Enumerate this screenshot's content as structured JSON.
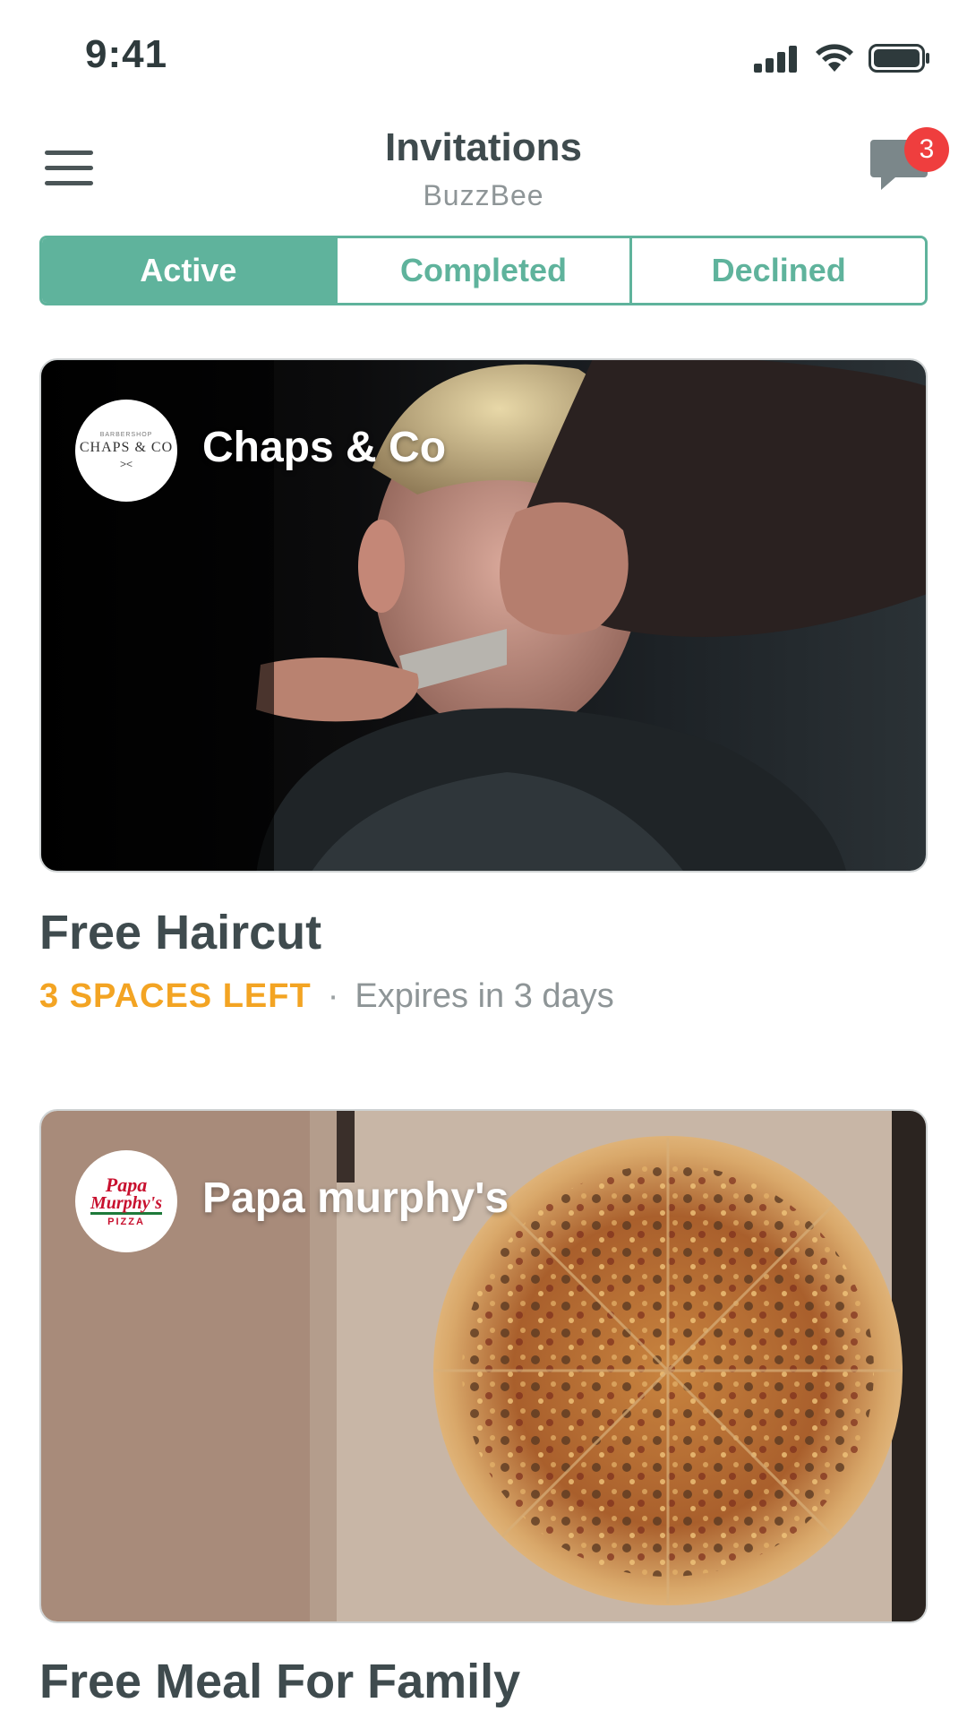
{
  "status": {
    "time": "9:41"
  },
  "header": {
    "title": "Invitations",
    "subtitle": "BuzzBee",
    "badge_count": "3"
  },
  "tabs": [
    {
      "label": "Active",
      "active": true
    },
    {
      "label": "Completed",
      "active": false
    },
    {
      "label": "Declined",
      "active": false
    }
  ],
  "cards": [
    {
      "brand": "Chaps & Co",
      "logo_text": "CHAPS & CO",
      "title": "Free Haircut",
      "spaces": "3 SPACES LEFT",
      "separator": "·",
      "expires": "Expires in 3 days"
    },
    {
      "brand": "Papa murphy's",
      "logo_line1": "Papa",
      "logo_line2": "Murphy's",
      "logo_line3": "PIZZA",
      "title": "Free Meal For Family"
    }
  ],
  "colors": {
    "accent": "#5fb39c",
    "badge": "#ef3e3e",
    "spaces_left": "#f3a423",
    "text_dark": "#3f4b4e",
    "text_muted": "#8e9597"
  }
}
